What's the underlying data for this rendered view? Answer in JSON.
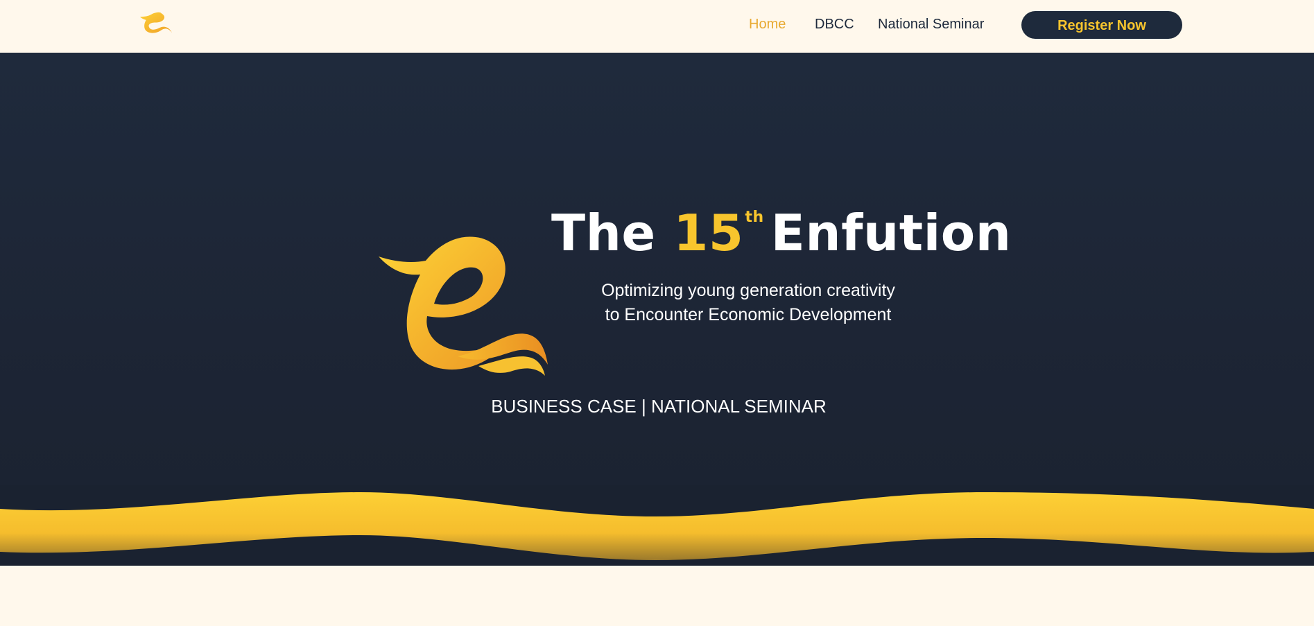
{
  "nav": {
    "logo_icon": "enfution-e-logo-icon",
    "links": [
      {
        "label": "Home",
        "active": true
      },
      {
        "label": "DBCC",
        "active": false
      },
      {
        "label": "National Seminar",
        "active": false
      }
    ],
    "register_label": "Register Now"
  },
  "hero": {
    "title_prefix": "The",
    "title_number": "15",
    "title_suffix_sup": "th",
    "title_name": "Enfution",
    "tagline_line1": "Optimizing young generation creativity",
    "tagline_line2": "to Encounter Economic Development",
    "categories": "BUSINESS CASE | NATIONAL SEMINAR",
    "logo_icon": "enfution-e-logo-icon"
  },
  "colors": {
    "navy": "#1e2a3c",
    "accent_yellow": "#f8c52d",
    "accent_orange": "#e8a930",
    "cream": "#fff8ec"
  }
}
